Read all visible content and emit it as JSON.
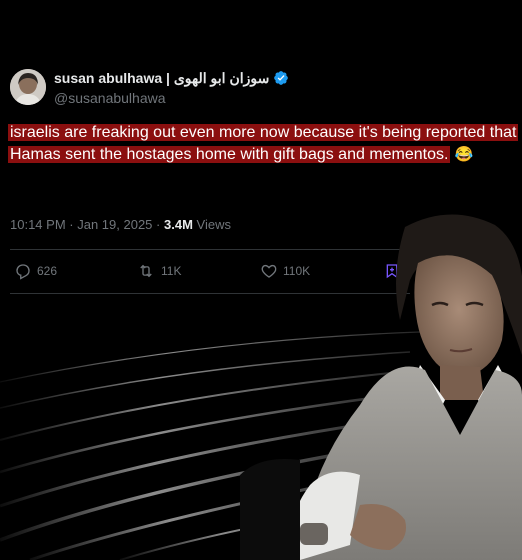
{
  "tweet": {
    "display_name": "susan abulhawa | سوزان ابو الهوى",
    "handle": "@susanabulhawa",
    "text_line1": "israelis are freaking out even more now because it's being reported that",
    "text_line2": "Hamas sent the hostages home with gift bags and mementos.",
    "emoji": "😂",
    "time": "10:14 PM",
    "date": "Jan 19, 2025",
    "views_count": "3.4M",
    "views_label": "Views"
  },
  "actions": {
    "replies": "626",
    "reposts": "11K",
    "likes": "110K"
  },
  "colors": {
    "background": "#000000",
    "highlight": "#8b0f0f",
    "verified_badge": "#1d9bf0",
    "bookmark": "#7856ff",
    "muted": "#71767b"
  },
  "icons": [
    "verified-badge-icon",
    "reply-icon",
    "repost-icon",
    "like-icon",
    "bookmark-icon"
  ]
}
